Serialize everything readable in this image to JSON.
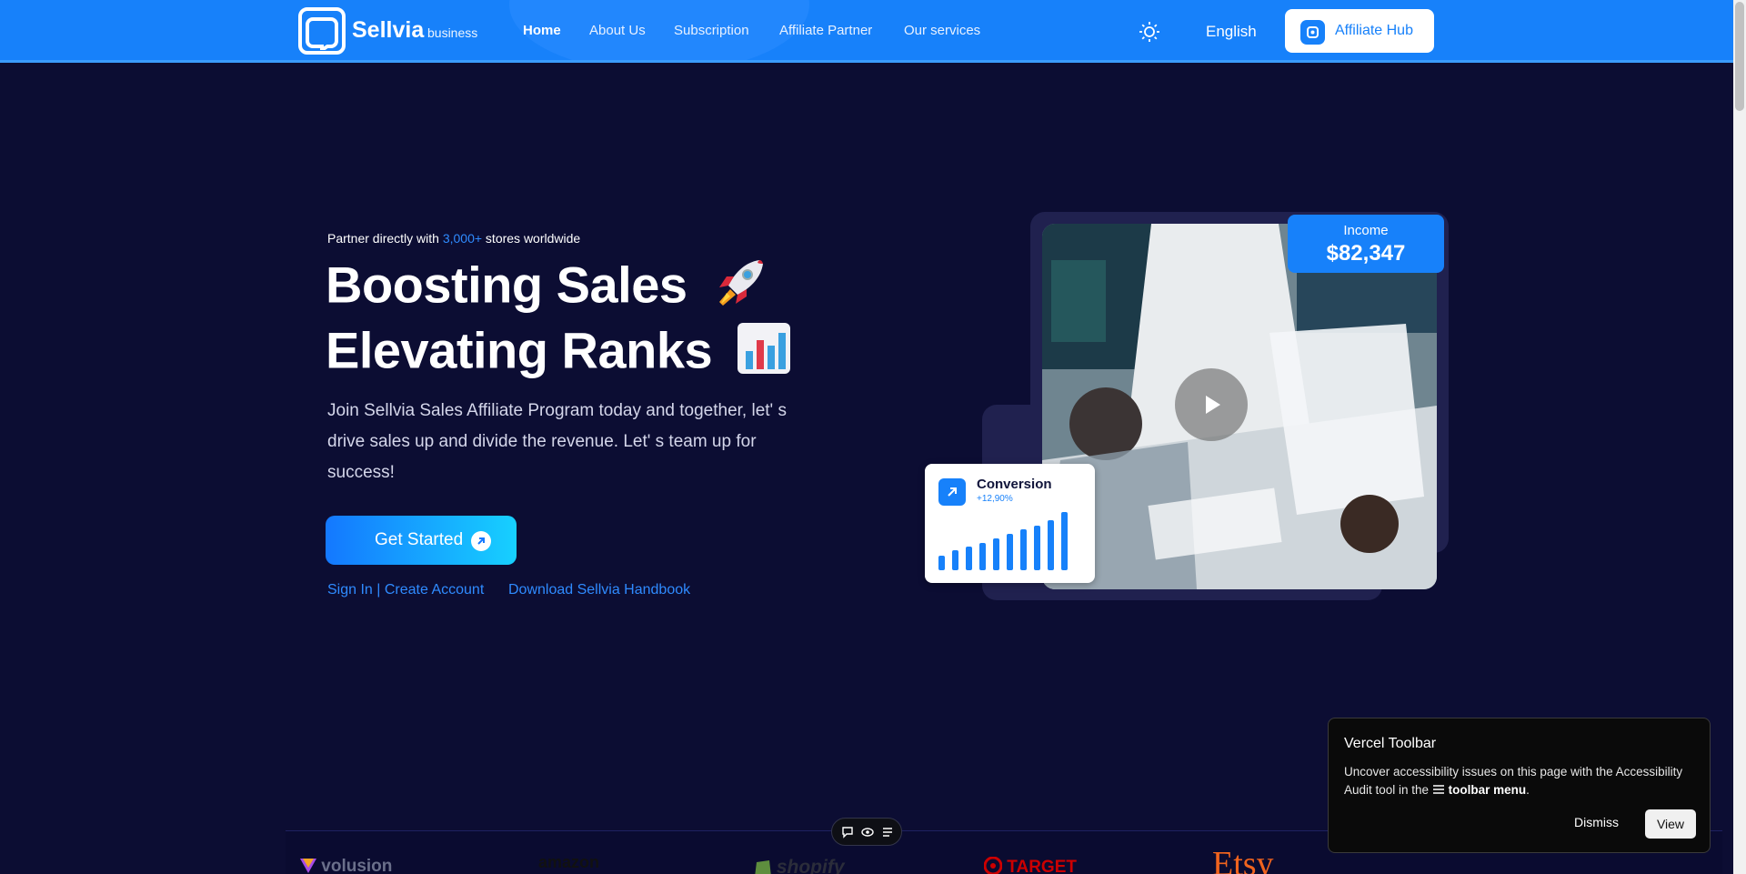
{
  "header": {
    "brand": "Sellvia",
    "brand_sub": "business",
    "nav": [
      {
        "label": "Home",
        "active": true
      },
      {
        "label": "About Us",
        "active": false
      },
      {
        "label": "Subscription",
        "active": false
      },
      {
        "label": "Affiliate Partner",
        "active": false
      },
      {
        "label": "Our services",
        "active": false
      }
    ],
    "theme_icon": "sun-icon",
    "language": "English",
    "hub_button": "Affiliate Hub"
  },
  "hero": {
    "tagline_prefix": "Partner directly with ",
    "tagline_highlight": "3,000+",
    "tagline_suffix": " stores worldwide",
    "headline_1": "Boosting Sales",
    "headline_2": "Elevating Ranks",
    "description": "Join Sellvia Sales Affiliate Program today and together, let' s drive sales up and divide the revenue. Let' s team up for success!",
    "cta": "Get Started",
    "link_signin": "Sign In | Create Account",
    "link_handbook": "Download Sellvia Handbook"
  },
  "media": {
    "income_label": "Income",
    "income_value": "$82,347",
    "conversion_title": "Conversion",
    "conversion_delta": "+12,90%"
  },
  "partners": [
    "volusion",
    "amazon",
    "shopify",
    "TARGET",
    "Etsy"
  ],
  "toast": {
    "title": "Vercel Toolbar",
    "body_prefix": "Uncover accessibility issues on this page with the Accessibility Audit tool in the ",
    "body_bold": "toolbar menu",
    "body_suffix": ".",
    "dismiss": "Dismiss",
    "view": "View"
  },
  "colors": {
    "accent": "#1781fa",
    "background": "#0c0d33"
  }
}
